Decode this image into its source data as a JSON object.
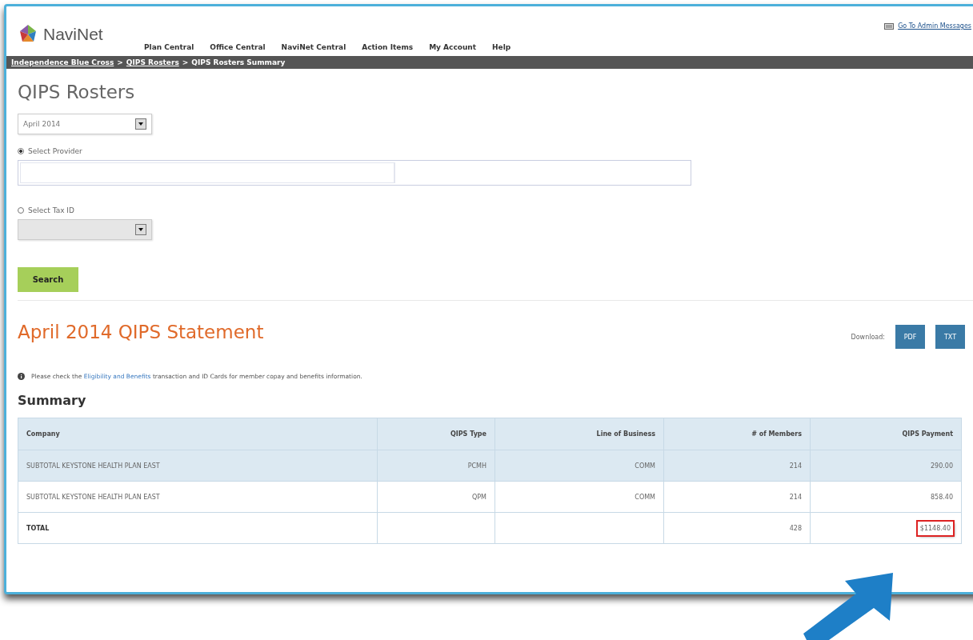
{
  "header": {
    "logo": "NaviNet",
    "nav": [
      "Plan Central",
      "Office Central",
      "NaviNet Central",
      "Action Items",
      "My Account",
      "Help"
    ],
    "admin_link": "Go To Admin Messages"
  },
  "breadcrumb": [
    "Independence Blue Cross",
    "QIPS Rosters",
    "QIPS Rosters Summary"
  ],
  "breadcrumb_separator": ">",
  "page_title": "QIPS Rosters",
  "period_select": {
    "value": "April 2014"
  },
  "options": [
    {
      "label": "Select Provider",
      "selected": true,
      "kind": "text"
    },
    {
      "label": "Select Tax ID",
      "selected": false,
      "kind": "select"
    }
  ],
  "search_button": "Search",
  "statement": {
    "title": "April 2014 QIPS Statement",
    "download_label": "Download:",
    "downloads": [
      "PDF",
      "TXT"
    ],
    "info": {
      "before": "Please check the ",
      "link": "Eligibility and Benefits",
      "after": " transaction and ID Cards for member copay and benefits information."
    }
  },
  "summary": {
    "title": "Summary",
    "columns": [
      "Company",
      "QIPS Type",
      "Line of Business",
      "# of Members",
      "QIPS Payment"
    ],
    "rows": [
      {
        "kind": "line",
        "cells": [
          "SUBTOTAL KEYSTONE HEALTH PLAN EAST",
          "PCMH",
          "COMM",
          "214",
          "290.00"
        ]
      },
      {
        "kind": "line",
        "cells": [
          "SUBTOTAL KEYSTONE HEALTH PLAN EAST",
          "QPM",
          "COMM",
          "214",
          "858.40"
        ]
      },
      {
        "kind": "total",
        "cells": [
          "TOTAL",
          "",
          "",
          "428",
          "$1148.40"
        ],
        "highlighted": true
      }
    ]
  }
}
